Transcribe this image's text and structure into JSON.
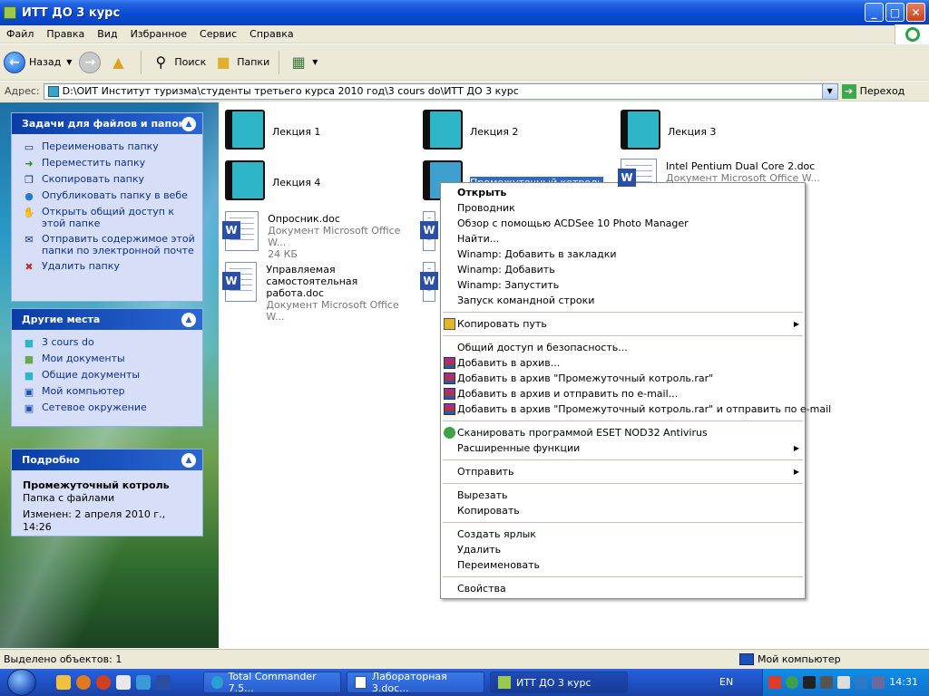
{
  "window": {
    "title": "ИТТ ДО 3 курс"
  },
  "menu": [
    "Файл",
    "Правка",
    "Вид",
    "Избранное",
    "Сервис",
    "Справка"
  ],
  "toolbar": {
    "back": "Назад",
    "search": "Поиск",
    "folders": "Папки"
  },
  "address": {
    "label": "Адрес:",
    "path": "D:\\ОИТ Институт туризма\\студенты третьего курса 2010 год\\3 cours do\\ИТТ ДО 3 курс",
    "go": "Переход"
  },
  "tasks_panel": {
    "title": "Задачи для файлов и папок",
    "items": [
      "Переименовать папку",
      "Переместить папку",
      "Скопировать папку",
      "Опубликовать папку в вебе",
      "Открыть общий доступ к этой папке",
      "Отправить содержимое этой папки по электронной почте",
      "Удалить папку"
    ]
  },
  "places_panel": {
    "title": "Другие места",
    "items": [
      "3 cours do",
      "Мои документы",
      "Общие документы",
      "Мой компьютер",
      "Сетевое окружение"
    ]
  },
  "details_panel": {
    "title": "Подробно",
    "name": "Промежуточный котроль",
    "type": "Папка с файлами",
    "modified": "Изменен: 2 апреля 2010 г., 14:26"
  },
  "files": {
    "f1": "Лекция 1",
    "f2": "Лекция 2",
    "f3": "Лекция 3",
    "f4": "Лекция 4",
    "f5": "Промежуточный котроль",
    "f6": {
      "name": "Intel Pentium Dual Core 2.doc",
      "type": "Документ Microsoft Office W..."
    },
    "f7": {
      "name": "Опросник.doc",
      "type": "Документ Microsoft Office W...",
      "size": "24 КБ"
    },
    "f8": {
      "name1": "Управляемая самостоятельная",
      "name2": "работа.doc",
      "type": "Документ Microsoft Office W..."
    }
  },
  "context_menu": {
    "open": "Открыть",
    "explorer": "Проводник",
    "acdsee": "Обзор с помощью ACDSee 10 Photo Manager",
    "find": "Найти...",
    "winamp_bookmark": "Winamp: Добавить в закладки",
    "winamp_add": "Winamp: Добавить",
    "winamp_play": "Winamp: Запустить",
    "cmd": "Запуск командной строки",
    "copy_path": "Копировать путь",
    "sharing": "Общий доступ и безопасность...",
    "rar_add": "Добавить в архив...",
    "rar_add_named": "Добавить в архив \"Промежуточный котроль.rar\"",
    "rar_email": "Добавить в архив и отправить по e-mail...",
    "rar_named_email": "Добавить в архив \"Промежуточный котроль.rar\" и отправить по e-mail",
    "eset": "Сканировать программой ESET NOD32 Antivirus",
    "advanced": "Расширенные функции",
    "send_to": "Отправить",
    "cut": "Вырезать",
    "copy": "Копировать",
    "shortcut": "Создать ярлык",
    "delete": "Удалить",
    "rename": "Переименовать",
    "properties": "Свойства"
  },
  "status": {
    "left": "Выделено объектов: 1",
    "right": "Мой компьютер"
  },
  "taskbar": {
    "tasks": [
      "Total Commander 7.5...",
      "Лабораторная 3.doc...",
      "ИТТ ДО 3 курс"
    ],
    "lang": "EN",
    "clock": "14:31"
  }
}
